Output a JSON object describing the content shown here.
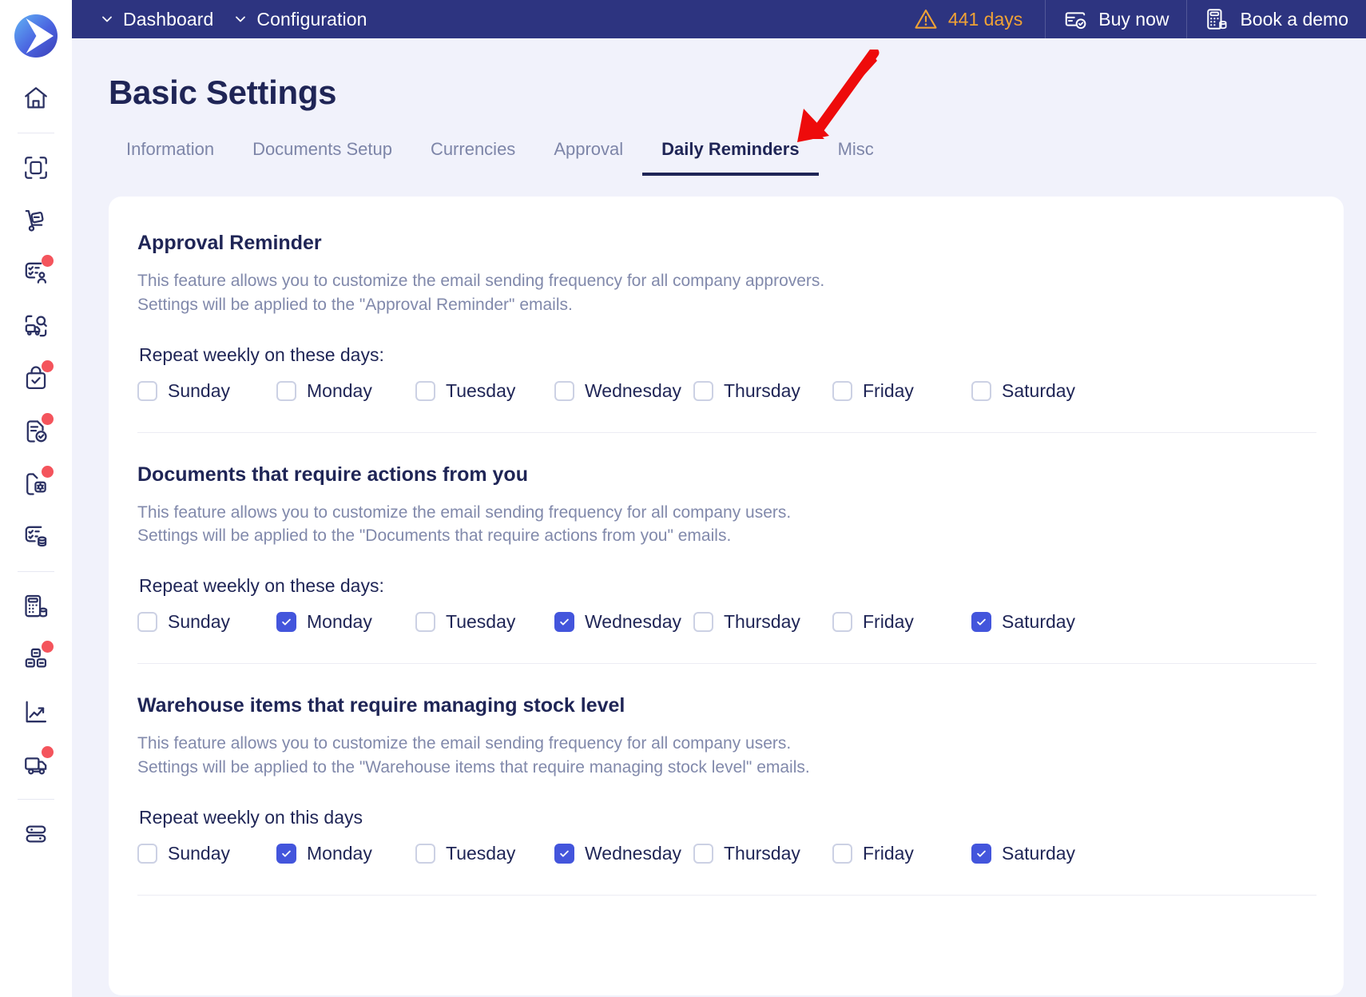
{
  "brand": {
    "logo_name": "app-logo",
    "accent": "#4355dc",
    "header_bg": "#2d3480",
    "page_bg": "#f1f2fb",
    "warning": "#f0a235",
    "badge": "#f4545c"
  },
  "topbar": {
    "breadcrumbs": [
      {
        "label": "Dashboard",
        "icon": "chevron-down-icon"
      },
      {
        "label": "Configuration",
        "icon": "chevron-down-icon"
      }
    ],
    "trial": {
      "label": "441 days",
      "icon": "warning-triangle-icon"
    },
    "actions": [
      {
        "label": "Buy now",
        "icon": "card-shield-icon"
      },
      {
        "label": "Book a demo",
        "icon": "calculator-icon"
      }
    ]
  },
  "sidebar": {
    "items": [
      {
        "name": "home",
        "icon": "home-icon",
        "badge": false
      },
      {
        "name": "scan-document",
        "icon": "scan-document-icon",
        "badge": false
      },
      {
        "name": "delivery-trolley",
        "icon": "hand-truck-icon",
        "badge": false
      },
      {
        "name": "approval-tasks",
        "icon": "checklist-user-icon",
        "badge": true
      },
      {
        "name": "shipment-search",
        "icon": "truck-search-icon",
        "badge": false
      },
      {
        "name": "purchase-approved",
        "icon": "bag-check-icon",
        "badge": true
      },
      {
        "name": "document-approved",
        "icon": "document-check-icon",
        "badge": true
      },
      {
        "name": "document-settings",
        "icon": "document-gear-icon",
        "badge": true
      },
      {
        "name": "checklist-database",
        "icon": "checklist-database-icon",
        "badge": false
      },
      {
        "name": "accounting",
        "icon": "calculator-database-icon",
        "badge": false
      },
      {
        "name": "inventory-blocks",
        "icon": "boxes-icon",
        "badge": true
      },
      {
        "name": "reports",
        "icon": "trend-chart-icon",
        "badge": false
      },
      {
        "name": "logistics",
        "icon": "truck-icon",
        "badge": true
      },
      {
        "name": "settings-toggles",
        "icon": "sliders-icon",
        "badge": false
      }
    ]
  },
  "page": {
    "title": "Basic Settings",
    "tabs": [
      {
        "label": "Information",
        "active": false
      },
      {
        "label": "Documents Setup",
        "active": false
      },
      {
        "label": "Currencies",
        "active": false
      },
      {
        "label": "Approval",
        "active": false
      },
      {
        "label": "Daily Reminders",
        "active": true
      },
      {
        "label": "Misc",
        "active": false
      }
    ]
  },
  "sections": [
    {
      "title": "Approval Reminder",
      "desc_line1": "This feature allows you to customize the email sending frequency for all company approvers.",
      "desc_line2": "Settings will be applied to the \"Approval Reminder\" emails.",
      "repeat_label": "Repeat weekly on these days:",
      "days": [
        {
          "label": "Sunday",
          "checked": false
        },
        {
          "label": "Monday",
          "checked": false
        },
        {
          "label": "Tuesday",
          "checked": false
        },
        {
          "label": "Wednesday",
          "checked": false
        },
        {
          "label": "Thursday",
          "checked": false
        },
        {
          "label": "Friday",
          "checked": false
        },
        {
          "label": "Saturday",
          "checked": false
        }
      ]
    },
    {
      "title": "Documents that require actions from you",
      "desc_line1": "This feature allows you to customize the email sending frequency for all company users.",
      "desc_line2": "Settings will be applied to the \"Documents that require actions from you\" emails.",
      "repeat_label": "Repeat weekly on these days:",
      "days": [
        {
          "label": "Sunday",
          "checked": false
        },
        {
          "label": "Monday",
          "checked": true
        },
        {
          "label": "Tuesday",
          "checked": false
        },
        {
          "label": "Wednesday",
          "checked": true
        },
        {
          "label": "Thursday",
          "checked": false
        },
        {
          "label": "Friday",
          "checked": false
        },
        {
          "label": "Saturday",
          "checked": true
        }
      ]
    },
    {
      "title": "Warehouse items that require managing stock level",
      "desc_line1": "This feature allows you to customize the email sending frequency for all company users.",
      "desc_line2": "Settings will be applied to the \"Warehouse items that require managing stock level\" emails.",
      "repeat_label": "Repeat weekly on this days",
      "days": [
        {
          "label": "Sunday",
          "checked": false
        },
        {
          "label": "Monday",
          "checked": true
        },
        {
          "label": "Tuesday",
          "checked": false
        },
        {
          "label": "Wednesday",
          "checked": true
        },
        {
          "label": "Thursday",
          "checked": false
        },
        {
          "label": "Friday",
          "checked": false
        },
        {
          "label": "Saturday",
          "checked": true
        }
      ]
    }
  ],
  "annotation": {
    "name": "red-arrow-pointing-to-daily-reminders-tab",
    "color": "#ee0b0b"
  }
}
